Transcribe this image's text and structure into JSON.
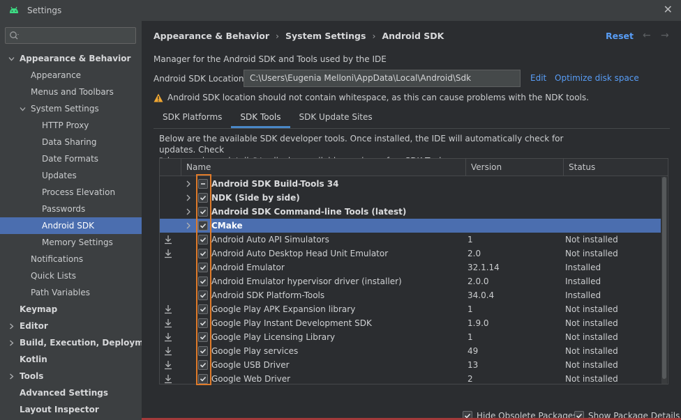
{
  "window": {
    "title": "Settings",
    "close_icon": "close-icon"
  },
  "sidebar": {
    "search_placeholder": "",
    "items": [
      {
        "label": "Appearance & Behavior",
        "level": 0,
        "bold": true,
        "arrow": "down"
      },
      {
        "label": "Appearance",
        "level": 1
      },
      {
        "label": "Menus and Toolbars",
        "level": 1
      },
      {
        "label": "System Settings",
        "level": 1,
        "arrow": "down"
      },
      {
        "label": "HTTP Proxy",
        "level": 2
      },
      {
        "label": "Data Sharing",
        "level": 2
      },
      {
        "label": "Date Formats",
        "level": 2
      },
      {
        "label": "Updates",
        "level": 2
      },
      {
        "label": "Process Elevation",
        "level": 2
      },
      {
        "label": "Passwords",
        "level": 2
      },
      {
        "label": "Android SDK",
        "level": 2,
        "selected": true
      },
      {
        "label": "Memory Settings",
        "level": 2
      },
      {
        "label": "Notifications",
        "level": 1
      },
      {
        "label": "Quick Lists",
        "level": 1
      },
      {
        "label": "Path Variables",
        "level": 1
      },
      {
        "label": "Keymap",
        "level": 0,
        "bold": true
      },
      {
        "label": "Editor",
        "level": 0,
        "bold": true,
        "arrow": "right"
      },
      {
        "label": "Build, Execution, Deployment",
        "level": 0,
        "bold": true,
        "arrow": "right"
      },
      {
        "label": "Kotlin",
        "level": 0,
        "bold": true
      },
      {
        "label": "Tools",
        "level": 0,
        "bold": true,
        "arrow": "right"
      },
      {
        "label": "Advanced Settings",
        "level": 0,
        "bold": true
      },
      {
        "label": "Layout Inspector",
        "level": 0,
        "bold": true
      }
    ]
  },
  "header": {
    "breadcrumb": [
      "Appearance & Behavior",
      "System Settings",
      "Android SDK"
    ],
    "reset_label": "Reset",
    "back_arrow": "←",
    "forward_arrow": "→"
  },
  "main": {
    "description": "Manager for the Android SDK and Tools used by the IDE",
    "location_label": "Android SDK Location:",
    "location_value": "C:\\Users\\Eugenia Melloni\\AppData\\Local\\Android\\Sdk",
    "edit_label": "Edit",
    "optimize_label": "Optimize disk space",
    "warning_text": "Android SDK location should not contain whitespace, as this can cause problems with the NDK tools.",
    "tabs": [
      "SDK Platforms",
      "SDK Tools",
      "SDK Update Sites"
    ],
    "active_tab": "SDK Tools",
    "info_line1": "Below are the available SDK developer tools. Once installed, the IDE will automatically check for updates. Check",
    "info_line2": "\"show package details\" to display available versions of an SDK Tool."
  },
  "table": {
    "columns": [
      "Name",
      "Version",
      "Status"
    ],
    "rows": [
      {
        "name": "Android SDK Build-Tools 34",
        "version": "",
        "status": "",
        "group": true,
        "check": "partial"
      },
      {
        "name": "NDK (Side by side)",
        "version": "",
        "status": "",
        "group": true,
        "check": "checked"
      },
      {
        "name": "Android SDK Command-line Tools (latest)",
        "version": "",
        "status": "",
        "group": true,
        "check": "checked"
      },
      {
        "name": "CMake",
        "version": "",
        "status": "",
        "group": true,
        "check": "checked",
        "selected": true
      },
      {
        "name": "Android Auto API Simulators",
        "version": "1",
        "status": "Not installed",
        "download": true,
        "check": "checked"
      },
      {
        "name": "Android Auto Desktop Head Unit Emulator",
        "version": "2.0",
        "status": "Not installed",
        "download": true,
        "check": "checked"
      },
      {
        "name": "Android Emulator",
        "version": "32.1.14",
        "status": "Installed",
        "check": "checked"
      },
      {
        "name": "Android Emulator hypervisor driver (installer)",
        "version": "2.0.0",
        "status": "Installed",
        "check": "checked"
      },
      {
        "name": "Android SDK Platform-Tools",
        "version": "34.0.4",
        "status": "Installed",
        "check": "checked"
      },
      {
        "name": "Google Play APK Expansion library",
        "version": "1",
        "status": "Not installed",
        "download": true,
        "check": "checked"
      },
      {
        "name": "Google Play Instant Development SDK",
        "version": "1.9.0",
        "status": "Not installed",
        "download": true,
        "check": "checked"
      },
      {
        "name": "Google Play Licensing Library",
        "version": "1",
        "status": "Not installed",
        "download": true,
        "check": "checked"
      },
      {
        "name": "Google Play services",
        "version": "49",
        "status": "Not installed",
        "download": true,
        "check": "checked"
      },
      {
        "name": "Google USB Driver",
        "version": "13",
        "status": "Not installed",
        "download": true,
        "check": "checked"
      },
      {
        "name": "Google Web Driver",
        "version": "2",
        "status": "Not installed",
        "download": true,
        "check": "checked"
      }
    ]
  },
  "footer": {
    "hide_obsolete_label": "Hide Obsolete Packages",
    "show_details_label": "Show Package Details"
  },
  "colors": {
    "accent": "#4b6eaf",
    "link": "#589df6",
    "highlight": "#e07b2a",
    "warning": "#f0a732"
  }
}
